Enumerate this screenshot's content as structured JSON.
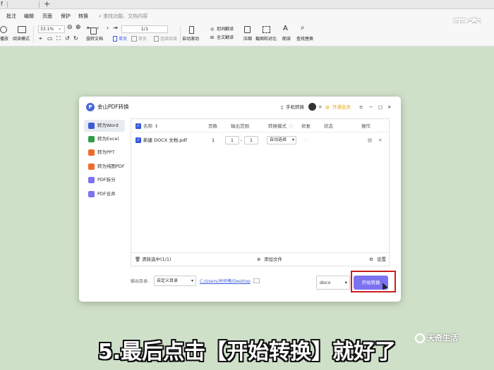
{
  "tabbar": {
    "tab_char": "f",
    "new_tab": "+"
  },
  "menu": {
    "items": [
      "批注",
      "编辑",
      "页面",
      "保护",
      "转换"
    ],
    "search": "查找功能、文档内容"
  },
  "brand": "天奇",
  "toolbar": {
    "zoom": "33.1%",
    "page": "1/1",
    "left_labels": [
      "播放",
      "阅读模式"
    ],
    "rotate": "旋转文档",
    "single": "单页",
    "double": "双页",
    "continuous": "连续阅读",
    "autoscroll": "自动滚动",
    "translate_sel": "划词翻译",
    "translate_all": "全文翻译",
    "compress": "压缩",
    "screenshot": "截图和对比",
    "read": "朗读",
    "replace": "查找替换"
  },
  "dialog": {
    "logo": "P",
    "title": "金山PDF转换",
    "phone_convert": "手机转换",
    "vip": "开通会员",
    "sidebar": [
      {
        "label": "转为Word",
        "color": "#3b5bdb",
        "active": true
      },
      {
        "label": "转为Excel",
        "color": "#2f9e44",
        "active": false
      },
      {
        "label": "转为PPT",
        "color": "#f06b2a",
        "active": false
      },
      {
        "label": "转为纯图PDF",
        "color": "#f06b2a",
        "active": false
      },
      {
        "label": "PDF拆分",
        "color": "#7b72f2",
        "active": false
      },
      {
        "label": "PDF合并",
        "color": "#7b72f2",
        "active": false
      }
    ],
    "table": {
      "headers": [
        "名称",
        "页数",
        "输出范围",
        "转换模式",
        "修复",
        "状态",
        "操作"
      ],
      "row": {
        "name": "新建 DOCX 文档.pdf",
        "pages": "1",
        "range_from": "1",
        "range_sep": "-",
        "range_to": "1",
        "mode": "自动选择"
      }
    },
    "footer": {
      "clear": "清除选中(1/1)",
      "add": "添加文件",
      "settings": "设置"
    },
    "output": {
      "label": "输出目录:",
      "dir_option": "自定义目录",
      "path": "C:/Users/肖师傅/Desktop",
      "format": "docx",
      "start": "开始转换"
    }
  },
  "caption": "5.最后点击【开始转换】就好了",
  "corner_brand": "天奇生活",
  "colors": {
    "background": "#cfe0c9",
    "accent": "#7b72f2",
    "highlight": "#cc1f1f"
  }
}
